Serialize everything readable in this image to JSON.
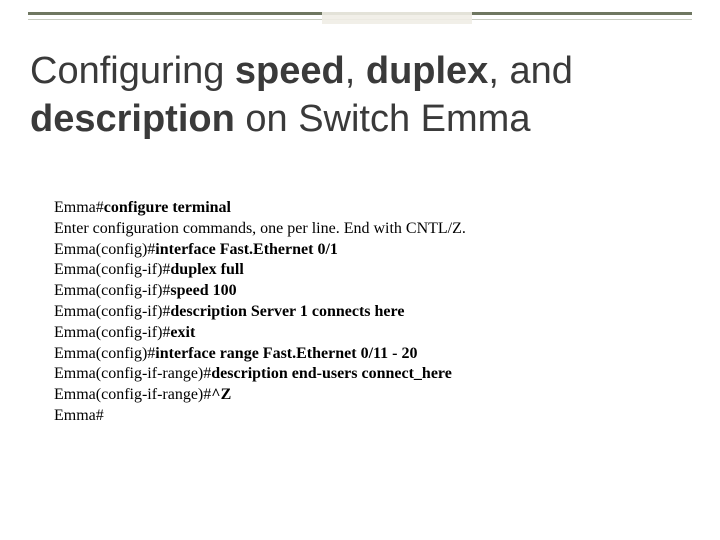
{
  "title": {
    "t1": "Configuring ",
    "t2": "speed",
    "t3": ", ",
    "t4": "duplex",
    "t5": ", and ",
    "t6": "description",
    "t7": " on Switch Emma"
  },
  "lines": {
    "l1a": "Emma#",
    "l1b": "configure terminal",
    "l2": "Enter configuration commands, one per line.  End with CNTL/Z.",
    "l3a": "Emma(config)#",
    "l3b": "interface Fast.Ethernet 0/1",
    "l4a": "Emma(config-if)#",
    "l4b": "duplex full",
    "l5a": "Emma(config-if)#",
    "l5b": "speed 100",
    "l6a": "Emma(config-if)#",
    "l6b": "description Server 1 connects here",
    "l7a": "Emma(config-if)#",
    "l7b": "exit",
    "l8a": "Emma(config)#",
    "l8b": "interface range Fast.Ethernet 0/11 - 20",
    "l9a": "Emma(config-if-range)#",
    "l9b": "description end-users connect_here",
    "l10a": "Emma(config-if-range)#",
    "l10b": "^Z",
    "l11": "Emma#"
  }
}
